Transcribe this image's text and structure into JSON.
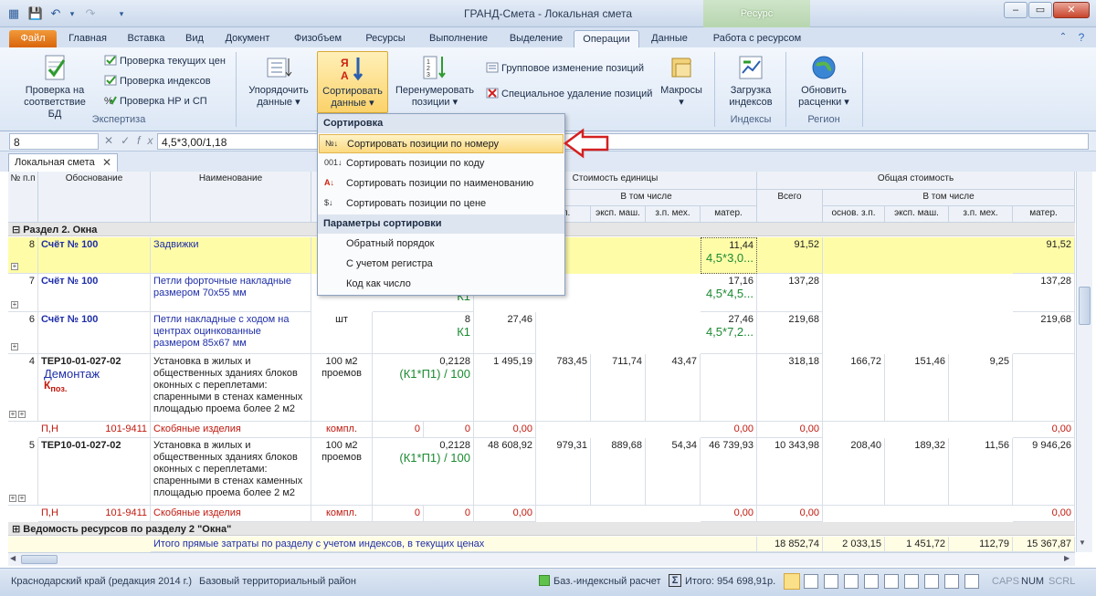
{
  "window": {
    "title": "ГРАНД-Смета - Локальная смета",
    "context_tab": "Ресурс"
  },
  "tabs": [
    "Файл",
    "Главная",
    "Вставка",
    "Вид",
    "Документ",
    "Физобъем",
    "Ресурсы",
    "Выполнение",
    "Выделение",
    "Операции",
    "Данные",
    "Работа с ресурсом"
  ],
  "ribbon": {
    "check_db": "Проверка на соответствие БД",
    "check_prices": "Проверка текущих цен",
    "check_indexes": "Проверка индексов",
    "check_nr": "Проверка НР и СП",
    "group_expertiza": "Экспертиза",
    "order_data": "Упорядочить данные",
    "sort_data": "Сортировать данные",
    "renumber": "Перенумеровать позиции",
    "group_change": "Групповое изменение позиций",
    "special_delete": "Специальное удаление позиций",
    "macros": "Макросы",
    "load_indexes": "Загрузка индексов",
    "group_indexes": "Индексы",
    "update_prices": "Обновить расценки",
    "group_region": "Регион"
  },
  "formula": {
    "cell": "8",
    "value": "4,5*3,00/1,18"
  },
  "doc_tab": "Локальная смета",
  "header": {
    "num": "№ п.п",
    "basis": "Обоснование",
    "name": "Наименование",
    "unit_cost": "Стоимость единицы",
    "total_cost": "Общая стоимость",
    "incl": "В том числе",
    "incl2": "В том числе",
    "osn": "з.п.",
    "eksp": "эксп. маш.",
    "zpmeh": "з.п. мех.",
    "mater": "матер.",
    "vsego": "Всего",
    "osn2": "основ. з.п.",
    "eksp2": "эксп. маш.",
    "zpmeh2": "з.п. мех.",
    "mater2": "матер."
  },
  "section": "Раздел 2. Окна",
  "rows": [
    {
      "num": "8",
      "basis": "Счёт № 100",
      "name": "Задвижки",
      "unit": "",
      "qty": "",
      "price": "",
      "osn": "",
      "eksp": "",
      "zpmeh": "",
      "mater": "11,44",
      "mater_formula": "4,5*3,0...",
      "total": "91,52",
      "t_osn": "",
      "t_eksp": "",
      "t_zpmeh": "",
      "t_mater": "91,52"
    },
    {
      "num": "7",
      "basis": "Счёт № 100",
      "name": "Петли форточные накладные размером 70х55 мм",
      "qty_formula": "К1",
      "mater": "17,16",
      "mater_formula": "4,5*4,5...",
      "total": "137,28",
      "t_mater": "137,28"
    },
    {
      "num": "6",
      "basis": "Счёт № 100",
      "name": "Петли накладные с ходом на центрах оцинкованные размером 85х67 мм",
      "unit": "шт",
      "qty": "8",
      "qty_formula": "К1",
      "price": "27,46",
      "mater": "27,46",
      "mater_formula": "4,5*7,2...",
      "total": "219,68",
      "t_mater": "219,68"
    },
    {
      "num": "4",
      "basis": "ТЕР10-01-027-02",
      "note": "Демонтаж",
      "kpoz": "К",
      "kpoz_sub": "поз.",
      "name": "Установка в жилых и общественных зданиях блоков оконных с переплетами: спаренными в стенах каменных площадью проема более 2 м2",
      "unit": "100 м2 проемов",
      "qty": "0,2128",
      "qty_formula": "(К1*П1) / 100",
      "price": "1 495,19",
      "osn": "783,45",
      "eksp": "711,74",
      "zpmeh": "43,47",
      "total": "318,18",
      "t_osn": "166,72",
      "t_eksp": "151,46",
      "t_zpmeh": "9,25"
    },
    {
      "num": "5",
      "basis": "ТЕР10-01-027-02",
      "name": "Установка в жилых и общественных зданиях блоков оконных с переплетами: спаренными в стенах каменных площадью проема более 2 м2",
      "unit": "100 м2 проемов",
      "qty": "0,2128",
      "qty_formula": "(К1*П1) / 100",
      "price": "48 608,92",
      "osn": "979,31",
      "eksp": "889,68",
      "zpmeh": "54,34",
      "mater": "46 739,93",
      "total": "10 343,98",
      "t_osn": "208,40",
      "t_eksp": "189,32",
      "t_zpmeh": "11,56",
      "t_mater": "9 946,26"
    }
  ],
  "sub_row": {
    "code": "П,Н",
    "id": "101-9411",
    "name": "Скобяные изделия",
    "unit": "компл.",
    "q": "0",
    "z1": "0",
    "z2": "0,00",
    "z3": "0,00",
    "z4": "0,00",
    "z5": "0,00"
  },
  "resources_section": "Ведомость ресурсов по разделу 2 \"Окна\"",
  "summary": {
    "label": "Итого прямые затраты по разделу с учетом индексов, в текущих ценах",
    "total": "18 852,74",
    "osn": "2 033,15",
    "eksp": "1 451,72",
    "zpmeh": "112,79",
    "mater": "15 367,87"
  },
  "menu": {
    "h1": "Сортировка",
    "i1": "Сортировать позиции по номеру",
    "i2": "Сортировать позиции по коду",
    "i3": "Сортировать позиции по наименованию",
    "i4": "Сортировать позиции по цене",
    "h2": "Параметры сортировки",
    "p1": "Обратный порядок",
    "p2": "С учетом регистра",
    "p3": "Код как число"
  },
  "status": {
    "region": "Краснодарский край (редакция 2014 г.)",
    "district": "Базовый территориальный район",
    "calc": "Баз.-индексный расчет",
    "total": "Итого: 954 698,91р.",
    "caps": "CAPS",
    "num": "NUM",
    "scrl": "SCRL"
  },
  "colors": {
    "highlight_row": "#fffca8",
    "arrow": "#d42020",
    "accent": "#f19a3a"
  }
}
